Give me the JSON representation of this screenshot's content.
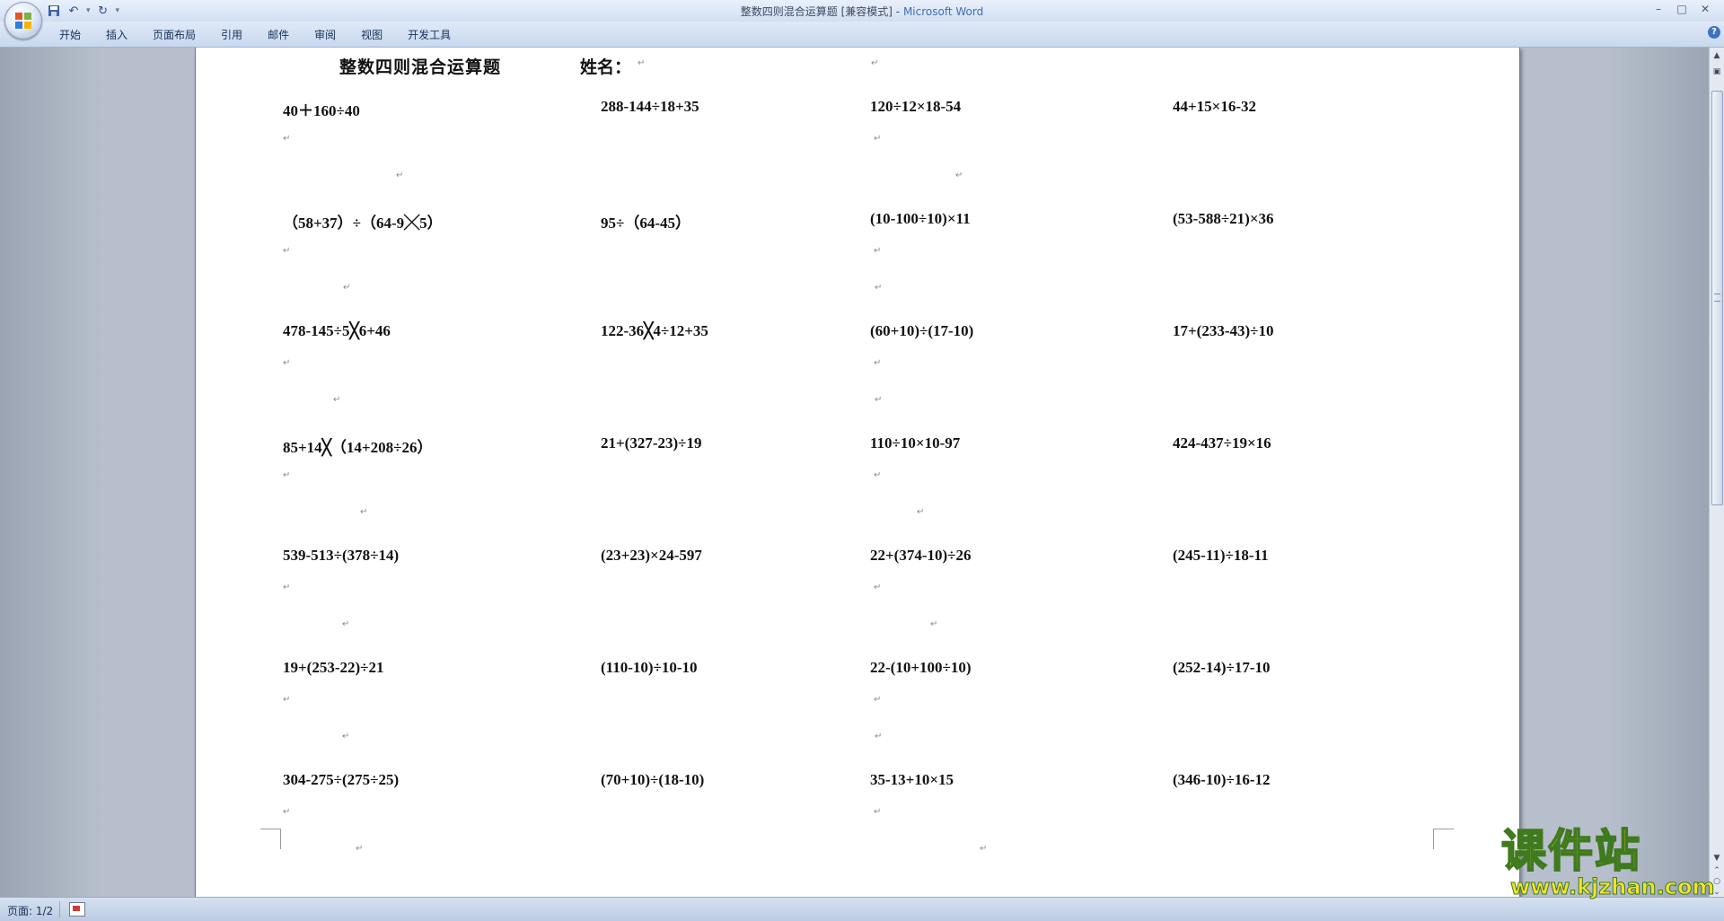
{
  "window": {
    "title": "整数四则混合运算题 [兼容模式]",
    "title_sep": " - ",
    "app": "Microsoft Word",
    "controls": [
      "–",
      "□",
      "✕"
    ]
  },
  "quick_access": {
    "items": [
      "save-icon",
      "undo-icon",
      "redo-icon",
      "customize-icon"
    ]
  },
  "ribbon": {
    "tabs": [
      "开始",
      "插入",
      "页面布局",
      "引用",
      "邮件",
      "审阅",
      "视图",
      "开发工具"
    ],
    "help": "?"
  },
  "document": {
    "title": "整数四则混合运算题",
    "name_label": "姓名：",
    "paragraph_mark": "↵",
    "rows": [
      [
        "40＋160÷40",
        "288-144÷18+35",
        "120÷12×18-54",
        "44+15×16-32"
      ],
      [
        "（58+37）÷（64-9╳5）",
        "95÷（64-45）",
        "(10-100÷10)×11",
        "(53-588÷21)×36"
      ],
      [
        "478-145÷5╳6+46",
        "122-36╳4÷12+35",
        "(60+10)÷(17-10)",
        "17+(233-43)÷10"
      ],
      [
        "85+14╳（14+208÷26）",
        "21+(327-23)÷19",
        "110÷10×10-97",
        "424-437÷19×16"
      ],
      [
        "539-513÷(378÷14)",
        "(23+23)×24-597",
        "22+(374-10)÷26",
        "(245-11)÷18-11"
      ],
      [
        "19+(253-22)÷21",
        "(110-10)÷10-10",
        "22-(10+100÷10)",
        "(252-14)÷17-10"
      ],
      [
        "304-275÷(275÷25)",
        "(70+10)÷(18-10)",
        "35-13+10×15",
        "(346-10)÷16-12"
      ]
    ]
  },
  "status": {
    "page": "页面: 1/2"
  },
  "watermark": {
    "text": "课件站",
    "url": "www.kjzhan.com"
  }
}
